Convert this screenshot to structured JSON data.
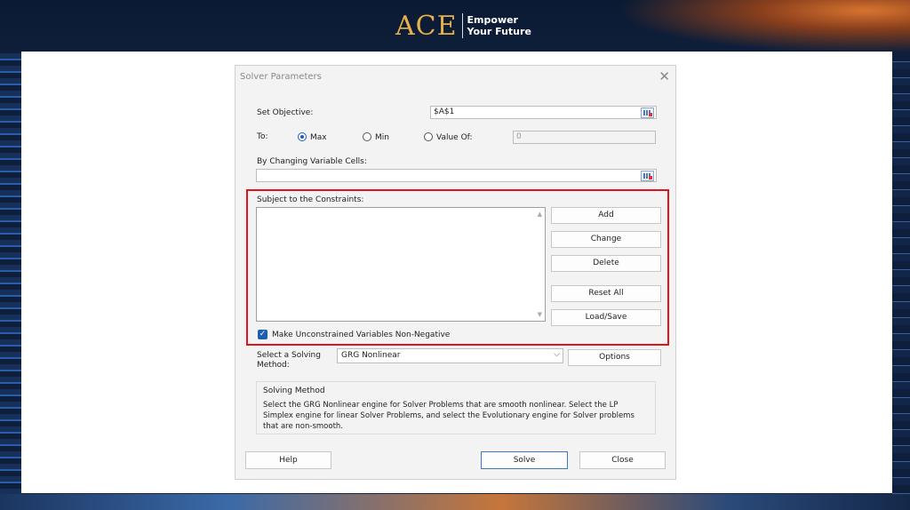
{
  "logo": {
    "brand": "ACE",
    "tagline_line1": "Empower",
    "tagline_line2": "Your Future"
  },
  "dialog": {
    "title": "Solver Parameters",
    "close_icon": "close-icon",
    "set_objective": {
      "label": "Set Objective:",
      "value": "$A$1"
    },
    "to": {
      "label": "To:",
      "options": [
        {
          "label": "Max",
          "checked": true
        },
        {
          "label": "Min",
          "checked": false
        },
        {
          "label": "Value Of:",
          "checked": false
        }
      ],
      "value_of": "0"
    },
    "changing_cells": {
      "label": "By Changing Variable Cells:",
      "value": ""
    },
    "constraints": {
      "label": "Subject to the Constraints:",
      "items": [],
      "buttons": [
        "Add",
        "Change",
        "Delete",
        "Reset All",
        "Load/Save"
      ]
    },
    "non_negative": {
      "label": "Make Unconstrained Variables Non-Negative",
      "checked": true
    },
    "solving_method": {
      "label_line1": "Select a Solving",
      "label_line2": "Method:",
      "selected": "GRG Nonlinear",
      "options_button": "Options"
    },
    "method_group": {
      "title": "Solving Method",
      "description": "Select the GRG Nonlinear engine for Solver Problems that are smooth nonlinear. Select the LP Simplex engine for linear Solver Problems, and select the Evolutionary engine for Solver problems that are non-smooth."
    },
    "footer": {
      "help": "Help",
      "solve": "Solve",
      "close": "Close"
    }
  },
  "colors": {
    "accent": "#1a5fb4",
    "highlight": "#e0141c",
    "logo_gold": "#e6b04a"
  }
}
